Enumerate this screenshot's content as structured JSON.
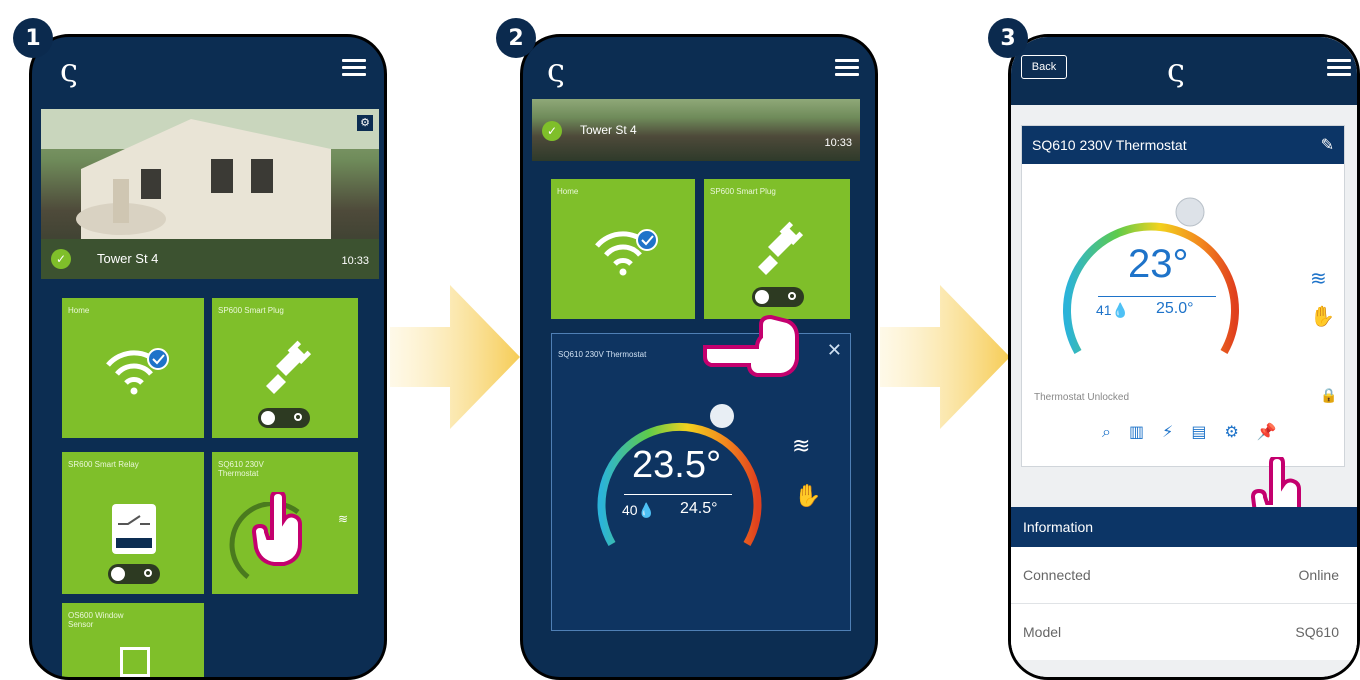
{
  "steps": [
    "1",
    "2",
    "3"
  ],
  "colors": {
    "app_bg": "#0c2d52",
    "tile_green": "#7fbf2a",
    "accent_magenta": "#c4006e",
    "arrow_yellow": "#f6cc55",
    "header_blue": "#0c3566"
  },
  "phone1": {
    "location_name": "Tower St 4",
    "time": "10:33",
    "tiles": [
      {
        "title": "Home",
        "icon": "wifi-check-icon"
      },
      {
        "title": "SP600 Smart Plug",
        "icon": "plug-icon"
      },
      {
        "title": "SR600 Smart Relay",
        "icon": "relay-icon"
      },
      {
        "title": "SQ610 230V Thermostat",
        "icon": "thermostat-icon"
      },
      {
        "title": "OS600 Window Sensor",
        "icon": "window-icon"
      }
    ]
  },
  "phone2": {
    "location_name": "Tower St 4",
    "time": "10:33",
    "tiles": [
      {
        "title": "Home",
        "icon": "wifi-check-icon"
      },
      {
        "title": "SP600 Smart Plug",
        "icon": "plug-icon"
      }
    ],
    "thermostat": {
      "title": "SQ610 230V Thermostat",
      "temperature": "23.5°",
      "humidity": "40",
      "setpoint": "24.5°"
    }
  },
  "phone3": {
    "back_label": "Back",
    "card_title": "SQ610 230V Thermostat",
    "temperature": "23°",
    "humidity": "41",
    "setpoint": "25.0°",
    "lock_status": "Thermostat Unlocked",
    "info_header": "Information",
    "info_rows": [
      {
        "label": "Connected",
        "value": "Online"
      },
      {
        "label": "Model",
        "value": "SQ610"
      }
    ]
  }
}
